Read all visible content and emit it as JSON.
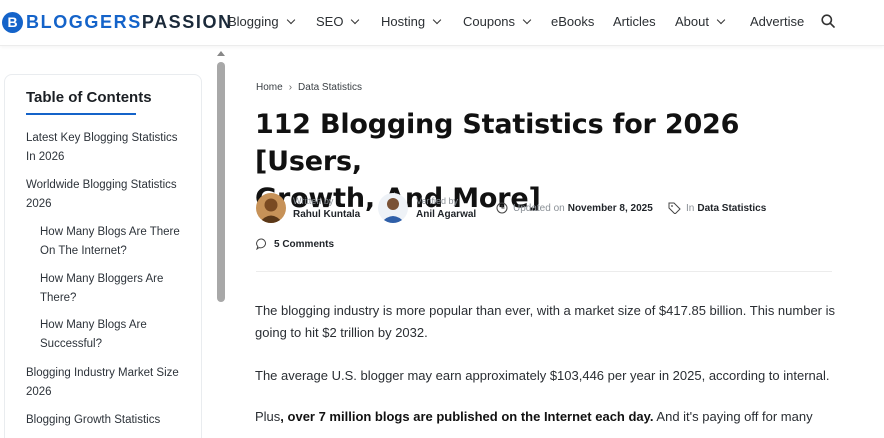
{
  "header": {
    "logo_letter": "B",
    "logo_part1": "BLOGGERS",
    "logo_part2": "PASSION",
    "nav": [
      {
        "label": "Blogging",
        "dropdown": true
      },
      {
        "label": "SEO",
        "dropdown": true
      },
      {
        "label": "Hosting",
        "dropdown": true
      },
      {
        "label": "Coupons",
        "dropdown": true
      },
      {
        "label": "eBooks",
        "dropdown": false
      },
      {
        "label": "Articles",
        "dropdown": false
      },
      {
        "label": "About",
        "dropdown": true
      },
      {
        "label": "Advertise",
        "dropdown": false
      }
    ],
    "search_icon": "search-icon"
  },
  "toc": {
    "title": "Table of Contents",
    "items": [
      {
        "l1": "Latest Key Blogging Statistics",
        "l2": "In 2026"
      },
      {
        "l1": "Worldwide Blogging Statistics",
        "l2": "2026"
      },
      {
        "l1": "How Many Blogs Are There",
        "l2": "On The Internet?"
      },
      {
        "l1": "How Many Bloggers Are",
        "l2": "There?"
      },
      {
        "l1": "How Many Blogs Are",
        "l2": "Successful?"
      },
      {
        "l1": "Blogging Industry Market Size",
        "l2": "2026"
      },
      {
        "l1": "Blogging Growth Statistics",
        "l2": ""
      }
    ]
  },
  "breadcrumb": {
    "home": "Home",
    "separator": "›",
    "current": "Data Statistics"
  },
  "article": {
    "title_line1": "112 Blogging Statistics for 2026 [Users,",
    "title_line2": "Growth, And More]",
    "author_label": "Written by",
    "author_name": "Rahul Kuntala",
    "verifier_label": "Verified by",
    "verifier_name": "Anil Agarwal",
    "updated_label": "Updated on",
    "updated_date": "November 8, 2025",
    "category_label": "In",
    "category": "Data Statistics",
    "comments": "5 Comments",
    "p1_line1": "The blogging industry is more popular than ever, with a market size of $417.85 billion. This number is",
    "p1_line2": "going to hit $2 trillion by 2032.",
    "p2": "The average U.S. blogger may earn approximately $103,446 per year in 2025, according to internal.",
    "p3_pre": "Plus",
    "p3_bold": ", over 7 million blogs are published on the Internet each day.",
    "p3_post": " And it's paying off for many"
  },
  "colors": {
    "brand_blue": "#1463c9",
    "brand_dark": "#1b2a3a"
  }
}
